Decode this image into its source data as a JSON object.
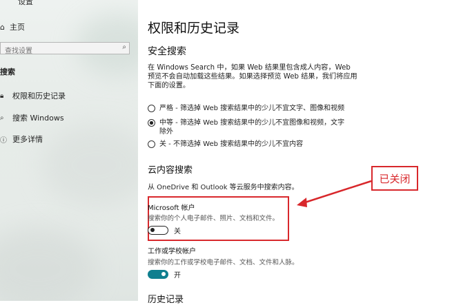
{
  "sidebar": {
    "app_title": "设置",
    "home_label": "主页",
    "search": {
      "placeholder": "查找设置"
    },
    "section_title": "搜索",
    "items": [
      {
        "label": "权限和历史记录",
        "icon": "lock-icon"
      },
      {
        "label": "搜索 Windows",
        "icon": "search-windows-icon"
      },
      {
        "label": "更多详情",
        "icon": "info-icon"
      }
    ]
  },
  "content": {
    "page_title": "权限和历史记录",
    "safe_search": {
      "heading": "安全搜索",
      "description": "在 Windows Search 中，如果 Web 结果里包含成人内容，Web 预览不会自动加载这些结果。如果选择预览 Web 结果，我们将应用下面的设置。",
      "options": [
        {
          "label": "严格 - 筛选掉 Web 搜索结果中的少儿不宜文字、图像和视频",
          "selected": false
        },
        {
          "label": "中等 - 筛选掉 Web 搜索结果中的少儿不宜图像和视频，文字除外",
          "selected": true
        },
        {
          "label": "关 - 不筛选掉 Web 搜索结果中的少儿不宜内容",
          "selected": false
        }
      ]
    },
    "cloud_search": {
      "heading": "云内容搜索",
      "description": "从 OneDrive 和 Outlook 等云服务中搜索内容。",
      "microsoft_account": {
        "title": "Microsoft 帐户",
        "description": "搜索你的个人电子邮件、照片、文档和文件。",
        "toggle_label": "关",
        "on": false
      },
      "work_account": {
        "title": "工作或学校帐户",
        "description": "搜索你的工作或学校电子邮件、文档、文件和人脉。",
        "toggle_label": "开",
        "on": true
      }
    },
    "history_heading": "历史记录"
  },
  "annotation": {
    "callout_text": "已关闭",
    "color": "#d8272b"
  },
  "colors": {
    "accent": "#0f7f8f",
    "annotation_red": "#d8272b"
  }
}
